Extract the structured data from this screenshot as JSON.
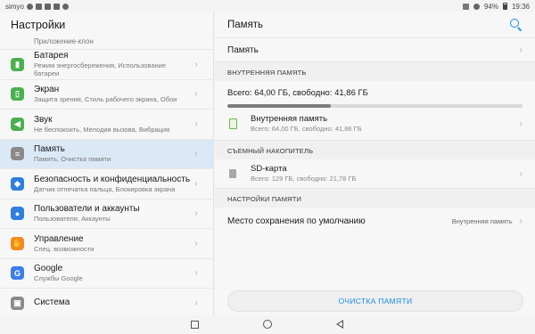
{
  "status": {
    "carrier": "simyo",
    "battery_text": "94%",
    "time": "19:36"
  },
  "left": {
    "title": "Настройки",
    "clipped_text": "Приложение-клон",
    "items": [
      {
        "label": "Батарея",
        "sub": "Режим энергосбережения, Использование батареи",
        "icon": "battery-icon",
        "color": "#4caf50"
      },
      {
        "label": "Экран",
        "sub": "Защита зрения, Стиль рабочего экрана, Обои",
        "icon": "screen-icon",
        "color": "#4caf50"
      },
      {
        "label": "Звук",
        "sub": "Не беспокоить, Мелодия вызова, Вибрация",
        "icon": "sound-icon",
        "color": "#4caf50"
      },
      {
        "label": "Память",
        "sub": "Память, Очистка памяти",
        "icon": "memory-icon",
        "color": "#8a8a8a"
      },
      {
        "label": "Безопасность и конфиденциальность",
        "sub": "Датчик отпечатка пальца, Блокировка экрана",
        "icon": "shield-icon",
        "color": "#2f7ee0"
      },
      {
        "label": "Пользователи и аккаунты",
        "sub": "Пользователи, Аккаунты",
        "icon": "user-icon",
        "color": "#2f7ee0"
      },
      {
        "label": "Управление",
        "sub": "Спец. возможности",
        "icon": "hand-icon",
        "color": "#f28a1e"
      },
      {
        "label": "Google",
        "sub": "Службы Google",
        "icon": "google-icon",
        "color": "#3b7de8"
      },
      {
        "label": "Система",
        "sub": "",
        "icon": "system-icon",
        "color": "#8a8a8a"
      }
    ]
  },
  "right": {
    "title": "Память",
    "memory_row": "Память",
    "section_internal": "ВНУТРЕННЯЯ ПАМЯТЬ",
    "summary": "Всего: 64,00 ГБ, свободно: 41,86 ГБ",
    "used_fraction": 0.35,
    "internal_label": "Внутренняя память",
    "internal_sub": "Всего: 64,00 ГБ, свободно: 41,86 ГБ",
    "section_removable": "СЪЕМНЫЙ НАКОПИТЕЛЬ",
    "sd_label": "SD-карта",
    "sd_sub": "Всего: 129 ГБ, свободно: 21,78 ГБ",
    "section_settings": "НАСТРОЙКИ ПАМЯТИ",
    "default_location_label": "Место сохранения по умолчанию",
    "default_location_value": "Внутренняя память",
    "clean_button": "ОЧИСТКА ПАМЯТИ"
  }
}
